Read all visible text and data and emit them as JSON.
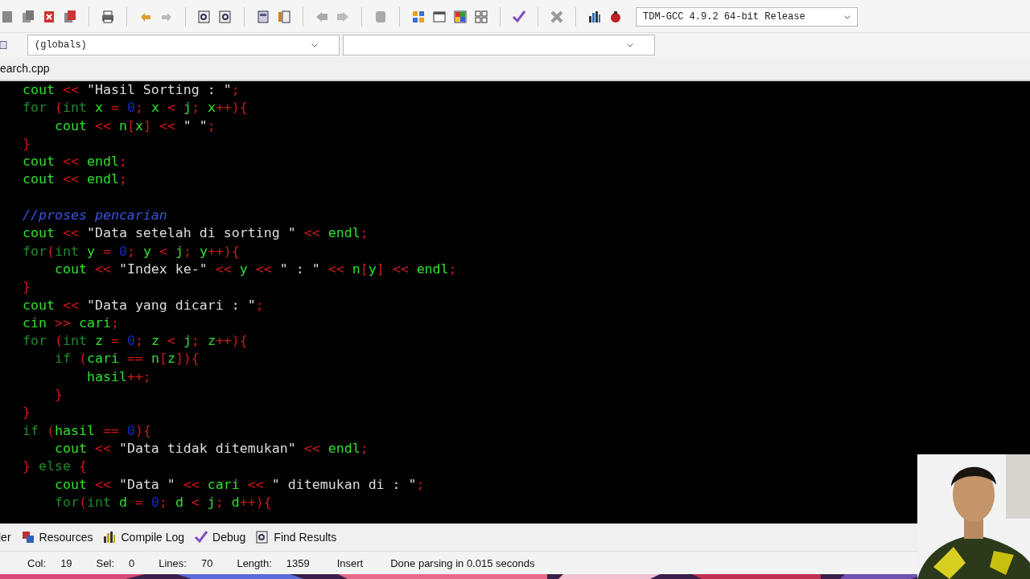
{
  "toolbar": {
    "compiler": "TDM-GCC 4.9.2 64-bit Release"
  },
  "class_bar": {
    "scope": "(globals)"
  },
  "file_tabs": [
    {
      "label": "earch.cpp"
    }
  ],
  "editor": {
    "lines": [
      {
        "kind": "code",
        "tokens": [
          {
            "kind": "id",
            "t": "cout"
          },
          {
            "kind": "op",
            "t": " << "
          },
          {
            "kind": "str",
            "t": "\"Hasil Sorting : \""
          },
          {
            "kind": "op",
            "t": ";"
          }
        ]
      },
      {
        "kind": "code",
        "tokens": [
          {
            "kind": "kw",
            "t": "for "
          },
          {
            "kind": "op",
            "t": "("
          },
          {
            "kind": "kw",
            "t": "int "
          },
          {
            "kind": "id",
            "t": "x"
          },
          {
            "kind": "op",
            "t": " = "
          },
          {
            "kind": "num",
            "t": "0"
          },
          {
            "kind": "op",
            "t": "; "
          },
          {
            "kind": "id",
            "t": "x"
          },
          {
            "kind": "op",
            "t": " < "
          },
          {
            "kind": "id",
            "t": "j"
          },
          {
            "kind": "op",
            "t": "; "
          },
          {
            "kind": "id",
            "t": "x"
          },
          {
            "kind": "op",
            "t": "++){"
          }
        ]
      },
      {
        "kind": "code",
        "tokens": [
          {
            "kind": "id",
            "t": "    cout"
          },
          {
            "kind": "op",
            "t": " << "
          },
          {
            "kind": "id",
            "t": "n"
          },
          {
            "kind": "op",
            "t": "["
          },
          {
            "kind": "id",
            "t": "x"
          },
          {
            "kind": "op",
            "t": "] << "
          },
          {
            "kind": "str",
            "t": "\" \""
          },
          {
            "kind": "op",
            "t": ";"
          }
        ]
      },
      {
        "kind": "code",
        "tokens": [
          {
            "kind": "op",
            "t": "}"
          }
        ]
      },
      {
        "kind": "code",
        "tokens": [
          {
            "kind": "id",
            "t": "cout"
          },
          {
            "kind": "op",
            "t": " << "
          },
          {
            "kind": "id",
            "t": "endl"
          },
          {
            "kind": "op",
            "t": ";"
          }
        ]
      },
      {
        "kind": "code",
        "tokens": [
          {
            "kind": "id",
            "t": "cout"
          },
          {
            "kind": "op",
            "t": " << "
          },
          {
            "kind": "id",
            "t": "endl"
          },
          {
            "kind": "op",
            "t": ";"
          }
        ]
      },
      {
        "kind": "blank"
      },
      {
        "kind": "code",
        "tokens": [
          {
            "kind": "cm",
            "t": "//proses pencarian"
          }
        ]
      },
      {
        "kind": "code",
        "tokens": [
          {
            "kind": "id",
            "t": "cout"
          },
          {
            "kind": "op",
            "t": " << "
          },
          {
            "kind": "str",
            "t": "\"Data setelah di sorting \""
          },
          {
            "kind": "op",
            "t": " << "
          },
          {
            "kind": "id",
            "t": "endl"
          },
          {
            "kind": "op",
            "t": ";"
          }
        ]
      },
      {
        "kind": "code",
        "tokens": [
          {
            "kind": "kw",
            "t": "for"
          },
          {
            "kind": "op",
            "t": "("
          },
          {
            "kind": "kw",
            "t": "int "
          },
          {
            "kind": "id",
            "t": "y"
          },
          {
            "kind": "op",
            "t": " = "
          },
          {
            "kind": "num",
            "t": "0"
          },
          {
            "kind": "op",
            "t": "; "
          },
          {
            "kind": "id",
            "t": "y"
          },
          {
            "kind": "op",
            "t": " < "
          },
          {
            "kind": "id",
            "t": "j"
          },
          {
            "kind": "op",
            "t": "; "
          },
          {
            "kind": "id",
            "t": "y"
          },
          {
            "kind": "op",
            "t": "++){"
          }
        ]
      },
      {
        "kind": "code",
        "tokens": [
          {
            "kind": "id",
            "t": "    cout"
          },
          {
            "kind": "op",
            "t": " << "
          },
          {
            "kind": "str",
            "t": "\"Index ke-\""
          },
          {
            "kind": "op",
            "t": " << "
          },
          {
            "kind": "id",
            "t": "y"
          },
          {
            "kind": "op",
            "t": " << "
          },
          {
            "kind": "str",
            "t": "\" : \""
          },
          {
            "kind": "op",
            "t": " << "
          },
          {
            "kind": "id",
            "t": "n"
          },
          {
            "kind": "op",
            "t": "["
          },
          {
            "kind": "id",
            "t": "y"
          },
          {
            "kind": "op",
            "t": "] << "
          },
          {
            "kind": "id",
            "t": "endl"
          },
          {
            "kind": "op",
            "t": ";"
          }
        ]
      },
      {
        "kind": "code",
        "tokens": [
          {
            "kind": "op",
            "t": "}"
          }
        ]
      },
      {
        "kind": "code",
        "tokens": [
          {
            "kind": "id",
            "t": "cout"
          },
          {
            "kind": "op",
            "t": " << "
          },
          {
            "kind": "str",
            "t": "\"Data yang dicari : \""
          },
          {
            "kind": "op",
            "t": ";"
          }
        ]
      },
      {
        "kind": "code",
        "tokens": [
          {
            "kind": "id",
            "t": "cin"
          },
          {
            "kind": "op",
            "t": " >> "
          },
          {
            "kind": "id",
            "t": "cari"
          },
          {
            "kind": "op",
            "t": ";"
          }
        ]
      },
      {
        "kind": "code",
        "tokens": [
          {
            "kind": "kw",
            "t": "for "
          },
          {
            "kind": "op",
            "t": "("
          },
          {
            "kind": "kw",
            "t": "int "
          },
          {
            "kind": "id",
            "t": "z"
          },
          {
            "kind": "op",
            "t": " = "
          },
          {
            "kind": "num",
            "t": "0"
          },
          {
            "kind": "op",
            "t": "; "
          },
          {
            "kind": "id",
            "t": "z"
          },
          {
            "kind": "op",
            "t": " < "
          },
          {
            "kind": "id",
            "t": "j"
          },
          {
            "kind": "op",
            "t": "; "
          },
          {
            "kind": "id",
            "t": "z"
          },
          {
            "kind": "op",
            "t": "++){"
          }
        ]
      },
      {
        "kind": "code",
        "tokens": [
          {
            "kind": "kw",
            "t": "    if "
          },
          {
            "kind": "op",
            "t": "("
          },
          {
            "kind": "id",
            "t": "cari"
          },
          {
            "kind": "op",
            "t": " == "
          },
          {
            "kind": "id",
            "t": "n"
          },
          {
            "kind": "op",
            "t": "["
          },
          {
            "kind": "id",
            "t": "z"
          },
          {
            "kind": "op",
            "t": "]){"
          }
        ]
      },
      {
        "kind": "code",
        "tokens": [
          {
            "kind": "id",
            "t": "        hasil"
          },
          {
            "kind": "op",
            "t": "++;"
          }
        ]
      },
      {
        "kind": "code",
        "tokens": [
          {
            "kind": "op",
            "t": "    }"
          }
        ]
      },
      {
        "kind": "code",
        "tokens": [
          {
            "kind": "op",
            "t": "}"
          }
        ]
      },
      {
        "kind": "code",
        "tokens": [
          {
            "kind": "kw",
            "t": "if "
          },
          {
            "kind": "op",
            "t": "("
          },
          {
            "kind": "id",
            "t": "hasil"
          },
          {
            "kind": "op",
            "t": " == "
          },
          {
            "kind": "num",
            "t": "0"
          },
          {
            "kind": "op",
            "t": "){"
          }
        ]
      },
      {
        "kind": "code",
        "tokens": [
          {
            "kind": "id",
            "t": "    cout"
          },
          {
            "kind": "op",
            "t": " << "
          },
          {
            "kind": "str",
            "t": "\"Data tidak ditemukan\""
          },
          {
            "kind": "op",
            "t": " << "
          },
          {
            "kind": "id",
            "t": "endl"
          },
          {
            "kind": "op",
            "t": ";"
          }
        ]
      },
      {
        "kind": "code",
        "tokens": [
          {
            "kind": "op",
            "t": "} "
          },
          {
            "kind": "kw",
            "t": "else "
          },
          {
            "kind": "op",
            "t": "{"
          }
        ]
      },
      {
        "kind": "code",
        "tokens": [
          {
            "kind": "id",
            "t": "    cout"
          },
          {
            "kind": "op",
            "t": " << "
          },
          {
            "kind": "str",
            "t": "\"Data \""
          },
          {
            "kind": "op",
            "t": " << "
          },
          {
            "kind": "id",
            "t": "cari"
          },
          {
            "kind": "op",
            "t": " << "
          },
          {
            "kind": "str",
            "t": "\" ditemukan di : \""
          },
          {
            "kind": "op",
            "t": ";"
          }
        ]
      },
      {
        "kind": "code",
        "tokens": [
          {
            "kind": "kw",
            "t": "    for"
          },
          {
            "kind": "op",
            "t": "("
          },
          {
            "kind": "kw",
            "t": "int "
          },
          {
            "kind": "id",
            "t": "d"
          },
          {
            "kind": "op",
            "t": " = "
          },
          {
            "kind": "num",
            "t": "0"
          },
          {
            "kind": "op",
            "t": "; "
          },
          {
            "kind": "id",
            "t": "d"
          },
          {
            "kind": "op",
            "t": " < "
          },
          {
            "kind": "id",
            "t": "j"
          },
          {
            "kind": "op",
            "t": "; "
          },
          {
            "kind": "id",
            "t": "d"
          },
          {
            "kind": "op",
            "t": "++){"
          }
        ]
      }
    ]
  },
  "bottom_tabs": [
    {
      "label": "ler",
      "kind": "compiler"
    },
    {
      "label": "Resources",
      "kind": "resources"
    },
    {
      "label": "Compile Log",
      "kind": "log"
    },
    {
      "label": "Debug",
      "kind": "debug"
    },
    {
      "label": "Find Results",
      "kind": "find"
    }
  ],
  "status_bar": [
    {
      "label": "Col:",
      "value": "19"
    },
    {
      "label": "Sel:",
      "value": "0"
    },
    {
      "label": "Lines:",
      "value": "70"
    },
    {
      "label": "Length:",
      "value": "1359"
    },
    {
      "label": "Insert"
    },
    {
      "label": "Done parsing in 0.015 seconds"
    }
  ]
}
